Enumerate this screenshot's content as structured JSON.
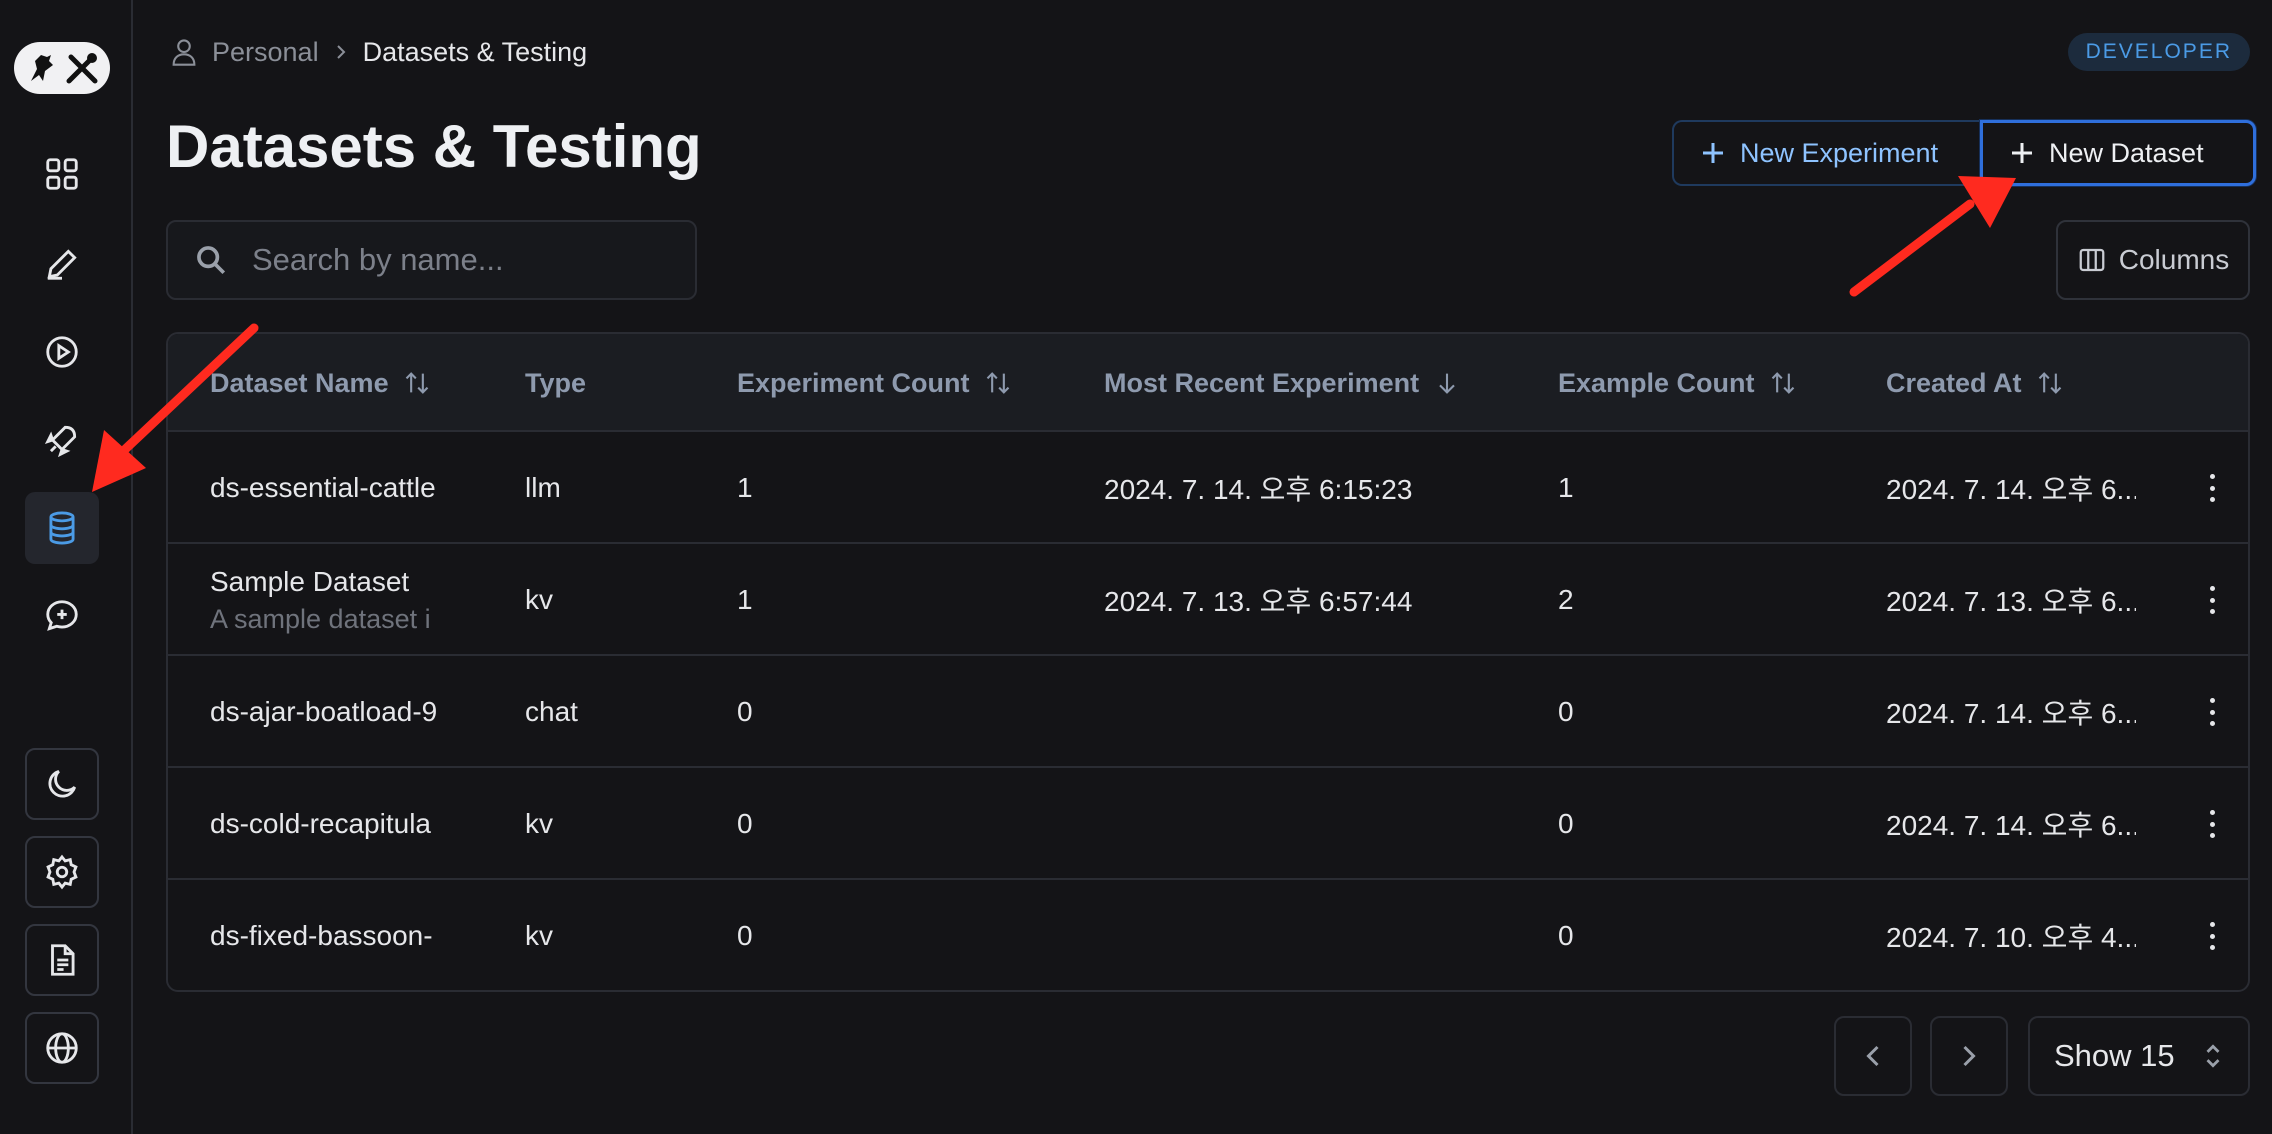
{
  "breadcrumb": {
    "parent": "Personal",
    "current": "Datasets & Testing"
  },
  "badge": "DEVELOPER",
  "page_title": "Datasets & Testing",
  "buttons": {
    "new_experiment": "New Experiment",
    "new_dataset": "New Dataset",
    "columns": "Columns"
  },
  "search": {
    "placeholder": "Search by name..."
  },
  "table": {
    "headers": [
      "Dataset Name",
      "Type",
      "Experiment Count",
      "Most Recent Experiment",
      "Example Count",
      "Created At"
    ],
    "rows": [
      {
        "name": "ds-essential-cattle",
        "desc": "",
        "type": "llm",
        "experiment_count": "1",
        "most_recent": "2024. 7. 14. 오후 6:15:23",
        "example_count": "1",
        "created": "2024. 7. 14. 오후 6..."
      },
      {
        "name": "Sample Dataset",
        "desc": "A sample dataset i",
        "type": "kv",
        "experiment_count": "1",
        "most_recent": "2024. 7. 13. 오후 6:57:44",
        "example_count": "2",
        "created": "2024. 7. 13. 오후 6..."
      },
      {
        "name": "ds-ajar-boatload-9",
        "desc": "",
        "type": "chat",
        "experiment_count": "0",
        "most_recent": "",
        "example_count": "0",
        "created": "2024. 7. 14. 오후 6..."
      },
      {
        "name": "ds-cold-recapitula",
        "desc": "",
        "type": "kv",
        "experiment_count": "0",
        "most_recent": "",
        "example_count": "0",
        "created": "2024. 7. 14. 오후 6..."
      },
      {
        "name": "ds-fixed-bassoon-",
        "desc": "",
        "type": "kv",
        "experiment_count": "0",
        "most_recent": "",
        "example_count": "0",
        "created": "2024. 7. 10. 오후 4..."
      }
    ]
  },
  "pagination": {
    "show_label": "Show 15"
  },
  "sidebar": {
    "top_items": [
      "dashboard-icon",
      "pen-icon",
      "play-icon",
      "rocket-icon",
      "database-icon",
      "chat-plus-icon"
    ],
    "bottom_items": [
      "moon-icon",
      "gear-icon",
      "document-icon",
      "globe-icon"
    ],
    "active": "database-icon"
  },
  "colors": {
    "accent": "#2f6fdc",
    "annotation": "#ff2a1f"
  }
}
